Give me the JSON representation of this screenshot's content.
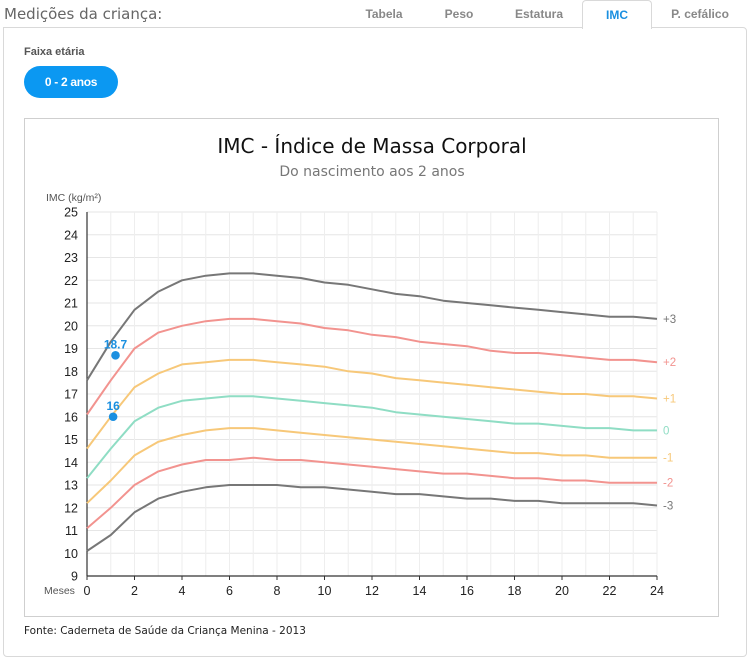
{
  "header": {
    "title": "Medições da criança:",
    "tabs": [
      {
        "label": "Tabela",
        "active": false
      },
      {
        "label": "Peso",
        "active": false
      },
      {
        "label": "Estatura",
        "active": false
      },
      {
        "label": "IMC",
        "active": true
      },
      {
        "label": "P. cefálico",
        "active": false
      }
    ]
  },
  "filter": {
    "label": "Faixa etária",
    "selected": "0 - 2 anos"
  },
  "colors": {
    "accent": "#0b98f2",
    "active_tab": "#1a8fe0",
    "z3": "#777777",
    "z2": "#f2938f",
    "z1": "#f7c879",
    "z0": "#8fddc4",
    "point": "#1a8fe0"
  },
  "chart_data": {
    "type": "line",
    "title": "IMC - Índice de Massa Corporal",
    "subtitle": "Do nascimento aos 2 anos",
    "xlabel": "Meses",
    "ylabel": "IMC (kg/m²)",
    "xlim": [
      0,
      24
    ],
    "ylim": [
      9,
      25
    ],
    "x_ticks": [
      0,
      2,
      4,
      6,
      8,
      10,
      12,
      14,
      16,
      18,
      20,
      22,
      24
    ],
    "y_ticks": [
      9,
      10,
      11,
      12,
      13,
      14,
      15,
      16,
      17,
      18,
      19,
      20,
      21,
      22,
      23,
      24,
      25
    ],
    "grid": true,
    "x": [
      0,
      1,
      2,
      3,
      4,
      5,
      6,
      7,
      8,
      9,
      10,
      11,
      12,
      13,
      14,
      15,
      16,
      17,
      18,
      19,
      20,
      21,
      22,
      23,
      24
    ],
    "series": [
      {
        "name": "+3",
        "color_key": "z3",
        "values": [
          17.6,
          19.3,
          20.7,
          21.5,
          22.0,
          22.2,
          22.3,
          22.3,
          22.2,
          22.1,
          21.9,
          21.8,
          21.6,
          21.4,
          21.3,
          21.1,
          21.0,
          20.9,
          20.8,
          20.7,
          20.6,
          20.5,
          20.4,
          20.4,
          20.3
        ]
      },
      {
        "name": "+2",
        "color_key": "z2",
        "values": [
          16.1,
          17.6,
          19.0,
          19.7,
          20.0,
          20.2,
          20.3,
          20.3,
          20.2,
          20.1,
          19.9,
          19.8,
          19.6,
          19.5,
          19.3,
          19.2,
          19.1,
          18.9,
          18.8,
          18.8,
          18.7,
          18.6,
          18.5,
          18.5,
          18.4
        ]
      },
      {
        "name": "+1",
        "color_key": "z1",
        "values": [
          14.6,
          16.0,
          17.3,
          17.9,
          18.3,
          18.4,
          18.5,
          18.5,
          18.4,
          18.3,
          18.2,
          18.0,
          17.9,
          17.7,
          17.6,
          17.5,
          17.4,
          17.3,
          17.2,
          17.1,
          17.0,
          17.0,
          16.9,
          16.9,
          16.8
        ]
      },
      {
        "name": "0",
        "color_key": "z0",
        "values": [
          13.3,
          14.6,
          15.8,
          16.4,
          16.7,
          16.8,
          16.9,
          16.9,
          16.8,
          16.7,
          16.6,
          16.5,
          16.4,
          16.2,
          16.1,
          16.0,
          15.9,
          15.8,
          15.7,
          15.7,
          15.6,
          15.5,
          15.5,
          15.4,
          15.4
        ]
      },
      {
        "name": "-1",
        "color_key": "z1",
        "values": [
          12.2,
          13.2,
          14.3,
          14.9,
          15.2,
          15.4,
          15.5,
          15.5,
          15.4,
          15.3,
          15.2,
          15.1,
          15.0,
          14.9,
          14.8,
          14.7,
          14.6,
          14.5,
          14.4,
          14.4,
          14.3,
          14.3,
          14.2,
          14.2,
          14.2
        ]
      },
      {
        "name": "-2",
        "color_key": "z2",
        "values": [
          11.1,
          12.0,
          13.0,
          13.6,
          13.9,
          14.1,
          14.1,
          14.2,
          14.1,
          14.1,
          14.0,
          13.9,
          13.8,
          13.7,
          13.6,
          13.5,
          13.5,
          13.4,
          13.3,
          13.3,
          13.2,
          13.2,
          13.1,
          13.1,
          13.1
        ]
      },
      {
        "name": "-3",
        "color_key": "z3",
        "values": [
          10.1,
          10.8,
          11.8,
          12.4,
          12.7,
          12.9,
          13.0,
          13.0,
          13.0,
          12.9,
          12.9,
          12.8,
          12.7,
          12.6,
          12.6,
          12.5,
          12.4,
          12.4,
          12.3,
          12.3,
          12.2,
          12.2,
          12.2,
          12.2,
          12.1
        ]
      }
    ],
    "points": [
      {
        "x": 1.2,
        "y": 18.7,
        "label": "18.7"
      },
      {
        "x": 1.1,
        "y": 16.0,
        "label": "16"
      }
    ]
  },
  "footer": {
    "source": "Fonte: Caderneta de Saúde da Criança Menina - 2013"
  }
}
